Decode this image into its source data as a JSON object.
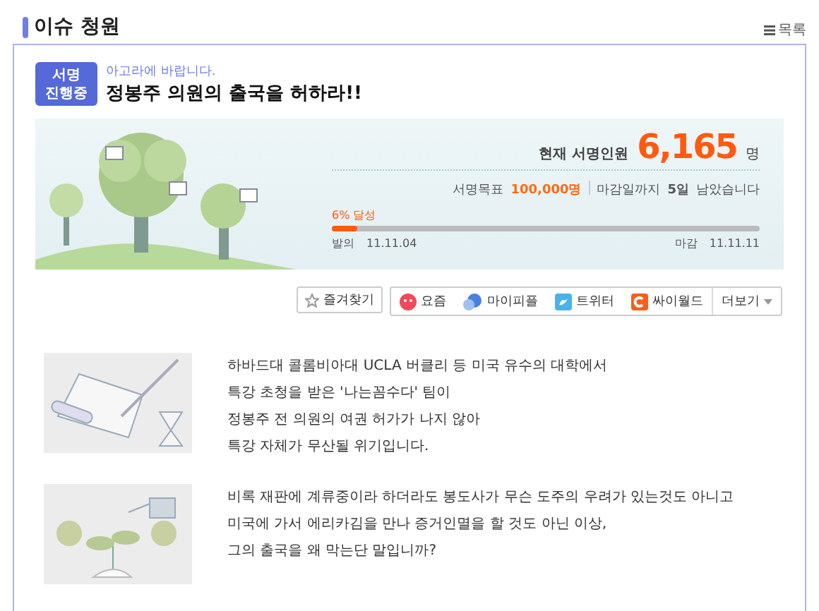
{
  "header": {
    "title": "이슈 청원",
    "list_link": "목록"
  },
  "petition": {
    "badge": [
      "서명",
      "진행중"
    ],
    "recipient": "아고라에 바랍니다.",
    "title": "정봉주 의원의 출국을 허하라!!",
    "current_label": "현재 서명인원",
    "current_count": "6,165",
    "count_unit": "명",
    "goal_label": "서명목표",
    "goal_value": "100,000명",
    "deadline_prefix": "마감일까지",
    "deadline_days": "5일",
    "deadline_suffix": "남았습니다",
    "progress": {
      "label": "6% 달성",
      "level": 0.06
    },
    "start": {
      "label": "발의",
      "date": "11.11.04"
    },
    "end": {
      "label": "마감",
      "date": "11.11.11"
    }
  },
  "actions": {
    "favorite": "즐겨찾기",
    "share": [
      {
        "kind": "yozm",
        "label": "요즘"
      },
      {
        "kind": "mypeople",
        "label": "마이피플"
      },
      {
        "kind": "twitter",
        "label": "트위터"
      },
      {
        "kind": "cyworld",
        "label": "싸이월드"
      }
    ],
    "more": "더보기"
  },
  "sections": [
    {
      "kind": "letter",
      "lines": [
        "하바드대 콜롬비아대 UCLA 버클리 등 미국 유수의 대학에서",
        "특강 초청을 받은 '나는꼼수다' 팀이",
        "정봉주 전 의원의 여권 허가가 나지 않아",
        "특강 자체가 무산될 위기입니다."
      ]
    },
    {
      "kind": "sprout",
      "lines": [
        "비록 재판에 계류중이라 하더라도 봉도사가 무슨 도주의 우려가 있는것도 아니고",
        "미국에 가서 에리카김을 만나 증거인멸을 할 것도 아닌 이상,",
        "그의 출국을 왜 막는단 말입니까?"
      ]
    }
  ]
}
